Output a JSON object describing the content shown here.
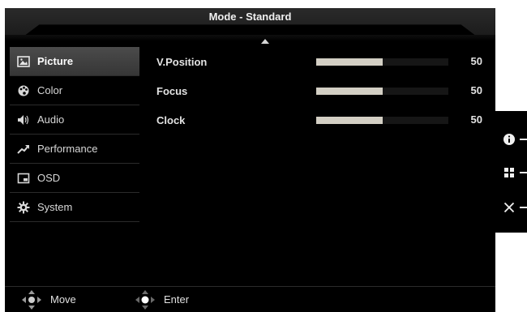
{
  "title": "Mode - Standard",
  "sidebar": {
    "items": [
      {
        "label": "Picture",
        "icon": "picture-icon",
        "active": true
      },
      {
        "label": "Color",
        "icon": "palette-icon",
        "active": false
      },
      {
        "label": "Audio",
        "icon": "speaker-icon",
        "active": false
      },
      {
        "label": "Performance",
        "icon": "trend-icon",
        "active": false
      },
      {
        "label": "OSD",
        "icon": "screen-icon",
        "active": false
      },
      {
        "label": "System",
        "icon": "gear-icon",
        "active": false
      }
    ]
  },
  "settings": [
    {
      "label": "V.Position",
      "value": "50",
      "level": 0.5
    },
    {
      "label": "Focus",
      "value": "50",
      "level": 0.5
    },
    {
      "label": "Clock",
      "value": "50",
      "level": 0.5
    }
  ],
  "footer": {
    "move_label": "Move",
    "enter_label": "Enter"
  },
  "hotkeys": [
    "info-icon",
    "grid-icon",
    "close-icon"
  ],
  "colors": {
    "background": "#000000",
    "active_item": "#454545",
    "slider_fill": "#d3cfc4",
    "text": "#e0e0e0"
  }
}
